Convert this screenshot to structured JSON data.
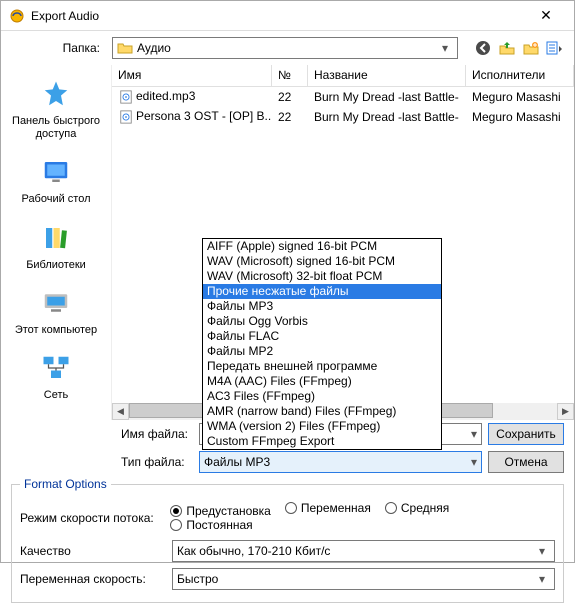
{
  "window": {
    "title": "Export Audio"
  },
  "folder": {
    "label": "Папка:",
    "value": "Аудио"
  },
  "toolbar_icons": [
    "back",
    "up",
    "new-folder",
    "views"
  ],
  "places": [
    {
      "id": "quick",
      "label": "Панель быстрого доступа"
    },
    {
      "id": "desktop",
      "label": "Рабочий стол"
    },
    {
      "id": "libs",
      "label": "Библиотеки"
    },
    {
      "id": "thispc",
      "label": "Этот компьютер"
    },
    {
      "id": "network",
      "label": "Сеть"
    }
  ],
  "columns": {
    "name": "Имя",
    "num": "№",
    "title": "Название",
    "artist": "Исполнители"
  },
  "files": [
    {
      "name": "edited.mp3",
      "num": "22",
      "title": "Burn My Dread -last Battle-",
      "artist": "Meguro Masashi"
    },
    {
      "name": "Persona 3 OST - [OP] B...",
      "num": "22",
      "title": "Burn My Dread -last Battle-",
      "artist": "Meguro Masashi"
    }
  ],
  "type_options": [
    "AIFF (Apple) signed 16-bit PCM",
    "WAV (Microsoft) signed 16-bit PCM",
    "WAV (Microsoft) 32-bit float PCM",
    "Прочие несжатые файлы",
    "Файлы MP3",
    "Файлы Ogg Vorbis",
    "Файлы FLAC",
    "Файлы MP2",
    "Передать внешней программе",
    "M4A (AAC) Files (FFmpeg)",
    "AC3 Files (FFmpeg)",
    "AMR (narrow band) Files (FFmpeg)",
    "WMA (version 2) Files (FFmpeg)",
    "Custom FFmpeg Export"
  ],
  "type_selected_index": 3,
  "filename": {
    "label": "Имя файла:",
    "value": ""
  },
  "filetype": {
    "label": "Тип файла:",
    "value": "Файлы MP3"
  },
  "buttons": {
    "save": "Сохранить",
    "cancel": "Отмена"
  },
  "format": {
    "legend": "Format Options",
    "bitrate_label": "Режим скорости потока:",
    "bitrate_opts": [
      "Предустановка",
      "Переменная",
      "Средняя",
      "Постоянная"
    ],
    "bitrate_selected": 0,
    "quality_label": "Качество",
    "quality_value": "Как обычно, 170-210 Кбит/с",
    "vbr_label": "Переменная скорость:",
    "vbr_value": "Быстро"
  }
}
